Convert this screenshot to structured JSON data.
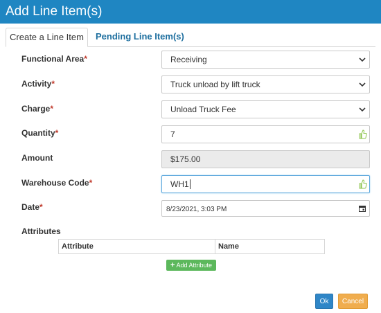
{
  "dialog": {
    "title": "Add Line Item(s)"
  },
  "tabs": [
    {
      "label": "Create a Line Item"
    },
    {
      "label": "Pending Line Item(s)"
    }
  ],
  "form": {
    "functional_area": {
      "label": "Functional Area",
      "required_mark": "*",
      "value": "Receiving"
    },
    "activity": {
      "label": "Activity",
      "required_mark": "*",
      "value": "Truck unload by lift truck"
    },
    "charge": {
      "label": "Charge",
      "required_mark": "*",
      "value": "Unload Truck Fee"
    },
    "quantity": {
      "label": "Quantity",
      "required_mark": "*",
      "value": "7"
    },
    "amount": {
      "label": "Amount",
      "value": "$175.00"
    },
    "warehouse_code": {
      "label": "Warehouse Code",
      "required_mark": "*",
      "value": "WH1"
    },
    "date": {
      "label": "Date",
      "required_mark": "*",
      "value": "8/23/2021, 3:03 PM"
    },
    "attributes": {
      "label": "Attributes",
      "columns": [
        "Attribute",
        "Name"
      ],
      "add_button": "Add Attribute"
    }
  },
  "footer": {
    "ok": "Ok",
    "cancel": "Cancel"
  },
  "colors": {
    "titlebar": "#1f86c2",
    "tab_inactive_text": "#1e6f9f",
    "required": "#c0392b",
    "add_button": "#5cb85c",
    "ok_button": "#2f86c7",
    "cancel_button": "#f0ad4e",
    "thumb_icon": "#8bc34a"
  },
  "icons": [
    "chevron-down-icon",
    "thumbs-up-icon",
    "calendar-icon",
    "plus-icon"
  ]
}
